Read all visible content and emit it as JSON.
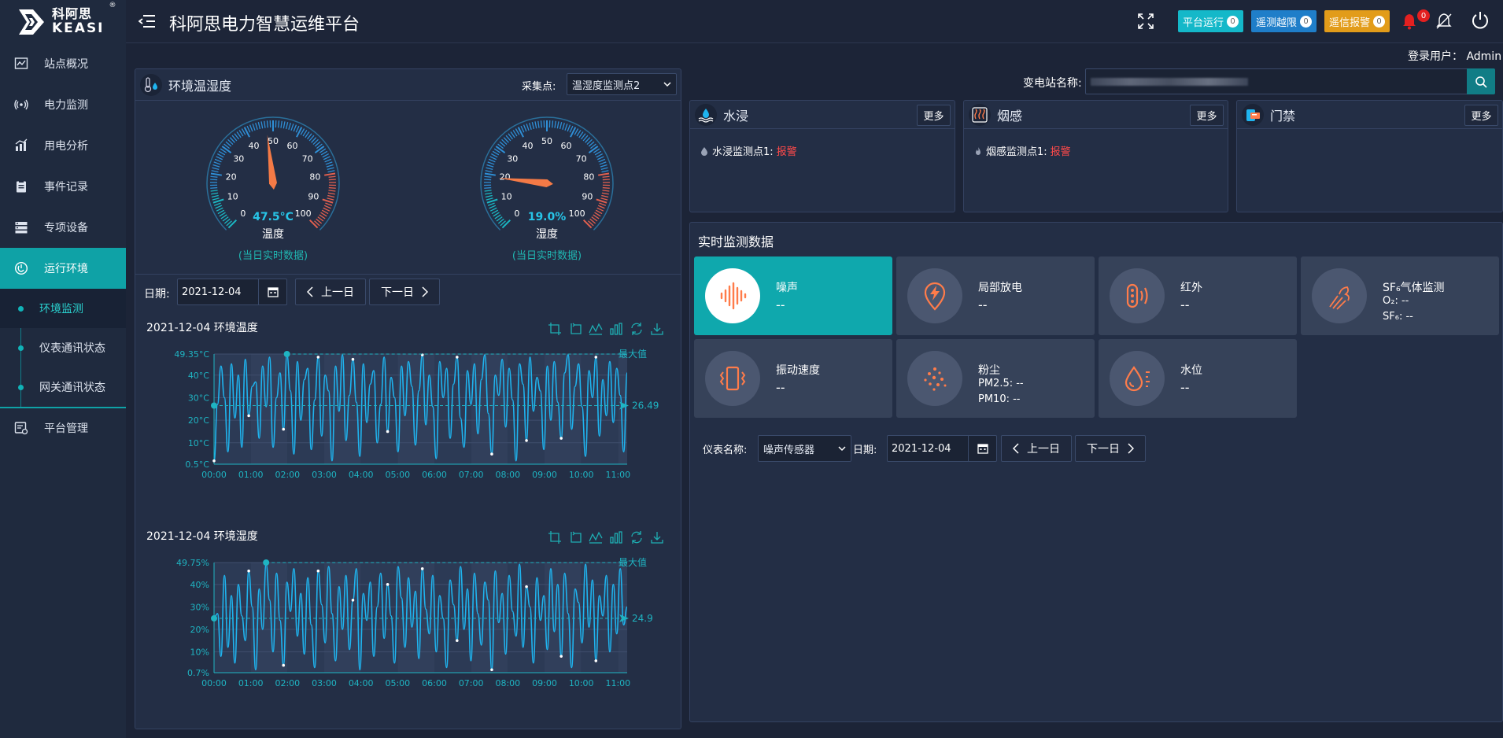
{
  "app": {
    "title": "科阿思电力智慧运维平台",
    "logo_cn": "科阿思",
    "logo_en": "KEASI",
    "logo_reg": "®"
  },
  "sidebar": {
    "items": [
      {
        "label": "站点概况",
        "icon": "chart-line-icon"
      },
      {
        "label": "电力监测",
        "icon": "signal-icon"
      },
      {
        "label": "用电分析",
        "icon": "bar-chart-icon"
      },
      {
        "label": "事件记录",
        "icon": "clipboard-icon"
      },
      {
        "label": "专项设备",
        "icon": "server-icon"
      },
      {
        "label": "运行环境",
        "icon": "power-icon"
      }
    ],
    "subitems": [
      {
        "label": "环境监测"
      },
      {
        "label": "仪表通讯状态"
      },
      {
        "label": "网关通讯状态"
      }
    ],
    "bottom_item": {
      "label": "平台管理",
      "icon": "settings-list-icon"
    }
  },
  "header": {
    "badges": [
      {
        "label": "平台运行",
        "count": "0",
        "color": "#14b8c9"
      },
      {
        "label": "遥测越限",
        "count": "0",
        "color": "#1f7ec9"
      },
      {
        "label": "遥信报警",
        "count": "0",
        "color": "#e29c1a"
      }
    ],
    "bell_count": "0",
    "login_label": "登录用户：",
    "login_user": "Admin"
  },
  "env": {
    "title": "环境温湿度",
    "collect_label": "采集点:",
    "collect_value": "温湿度监测点2",
    "temp": {
      "value": 47.5,
      "text": "47.5°C",
      "label": "温度",
      "note": "(当日实时数据)",
      "ticks": [
        "0",
        "10",
        "20",
        "30",
        "40",
        "50",
        "60",
        "70",
        "80",
        "90",
        "100"
      ]
    },
    "humi": {
      "value": 19.0,
      "text": "19.0%",
      "label": "湿度",
      "note": "(当日实时数据)",
      "ticks": [
        "0",
        "10",
        "20",
        "30",
        "40",
        "50",
        "60",
        "70",
        "80",
        "90",
        "100"
      ]
    },
    "date_label": "日期:",
    "date_value": "2021-12-04",
    "prev_label": "上一日",
    "next_label": "下一日",
    "temp_chart_title": "2021-12-04 环境温度",
    "humi_chart_title": "2021-12-04 环境湿度"
  },
  "chart_data": [
    {
      "type": "line",
      "title": "2021-12-04 环境温度",
      "x_ticks": [
        "00:00",
        "01:00",
        "02:00",
        "03:00",
        "04:00",
        "05:00",
        "06:00",
        "07:00",
        "08:00",
        "09:00",
        "10:00",
        "11:00"
      ],
      "y_ticks": [
        "0.5°C",
        "10°C",
        "20°C",
        "30°C",
        "40°C",
        "49.35°C"
      ],
      "y_tick_values": [
        0.5,
        10,
        20,
        30,
        40,
        49.35
      ],
      "ylim": [
        0.5,
        49.35
      ],
      "x_range_hours": [
        0,
        11.25
      ],
      "max_label": "最大值",
      "avg_value": "26.49",
      "series": [
        {
          "values": [
            2,
            27,
            44,
            30,
            6,
            45,
            21,
            40,
            8,
            47,
            22,
            35,
            37,
            12,
            44,
            26,
            48,
            8,
            30,
            41,
            16,
            49,
            33,
            5,
            46,
            20,
            38,
            43,
            7,
            29,
            48,
            13,
            40,
            33,
            2,
            44,
            24,
            49,
            11,
            31,
            47,
            28,
            4,
            45,
            19,
            36,
            42,
            10,
            27,
            48,
            15,
            39,
            30,
            6,
            44,
            22,
            46,
            35,
            9,
            33,
            49,
            18,
            40,
            26,
            3,
            46,
            30,
            43,
            12,
            36,
            48,
            21,
            8,
            42,
            27,
            45,
            14,
            38,
            49,
            23,
            5,
            40,
            31,
            47,
            17,
            43,
            29,
            2,
            45,
            36,
            11,
            48,
            24,
            39,
            33,
            7,
            44,
            20,
            46,
            28,
            12,
            41,
            49,
            16,
            35,
            45,
            26,
            4,
            42,
            30,
            48,
            13,
            38,
            22,
            46,
            19,
            43,
            31,
            6,
            41
          ]
        }
      ]
    },
    {
      "type": "line",
      "title": "2021-12-04 环境湿度",
      "x_ticks": [
        "00:00",
        "01:00",
        "02:00",
        "03:00",
        "04:00",
        "05:00",
        "06:00",
        "07:00",
        "08:00",
        "09:00",
        "10:00",
        "11:00"
      ],
      "y_ticks": [
        "0.7%",
        "10%",
        "20%",
        "30%",
        "40%",
        "49.75%"
      ],
      "y_tick_values": [
        0.7,
        10,
        20,
        30,
        40,
        49.75
      ],
      "ylim": [
        0.7,
        49.75
      ],
      "x_range_hours": [
        0,
        11.25
      ],
      "max_label": "最大值",
      "avg_value": "24.9",
      "series": [
        {
          "values": [
            25,
            27,
            8,
            44,
            12,
            35,
            5,
            40,
            26,
            15,
            46,
            30,
            2,
            38,
            20,
            49,
            33,
            10,
            45,
            24,
            4,
            41,
            28,
            47,
            17,
            36,
            9,
            43,
            22,
            3,
            46,
            31,
            14,
            48,
            27,
            6,
            39,
            20,
            44,
            11,
            33,
            47,
            2,
            36,
            24,
            41,
            8,
            30,
            45,
            16,
            40,
            26,
            5,
            48,
            34,
            12,
            43,
            21,
            37,
            7,
            47,
            29,
            18,
            44,
            10,
            35,
            25,
            3,
            42,
            31,
            15,
            48,
            20,
            38,
            6,
            45,
            27,
            13,
            41,
            33,
            2,
            46,
            23,
            36,
            9,
            44,
            28,
            17,
            49,
            12,
            39,
            30,
            5,
            43,
            24,
            35,
            11,
            47,
            19,
            40,
            8,
            45,
            27,
            3,
            38,
            32,
            14,
            49,
            21,
            42,
            6,
            35,
            26,
            44,
            10,
            40,
            18,
            47,
            22,
            30
          ]
        }
      ]
    }
  ],
  "right": {
    "station_label": "变电站名称:",
    "cards": [
      {
        "title": "水浸",
        "more": "更多",
        "item_label": "水浸监测点1:",
        "item_status": "报警"
      },
      {
        "title": "烟感",
        "more": "更多",
        "item_label": "烟感监测点1:",
        "item_status": "报警"
      },
      {
        "title": "门禁",
        "more": "更多"
      }
    ],
    "realtime_title": "实时监测数据",
    "tiles": [
      {
        "name": "噪声",
        "value": "--"
      },
      {
        "name": "局部放电",
        "value": "--"
      },
      {
        "name": "红外",
        "value": "--"
      },
      {
        "name": "SF₆气体监测",
        "o2": "O₂:  --",
        "sf6": "SF₆:  --"
      },
      {
        "name": "振动速度",
        "value": "--"
      },
      {
        "name": "粉尘",
        "pm25": "PM2.5:  --",
        "pm10": "PM10:  --"
      },
      {
        "name": "水位",
        "value": "--"
      }
    ],
    "meter_label": "仪表名称:",
    "meter_value": "噪声传感器",
    "date_label": "日期:",
    "date_value": "2021-12-04",
    "prev_label": "上一日",
    "next_label": "下一日"
  },
  "colors": {
    "accent": "#0fa8ad",
    "line": "#1fb4ef",
    "alarm": "#ff4a4a"
  }
}
